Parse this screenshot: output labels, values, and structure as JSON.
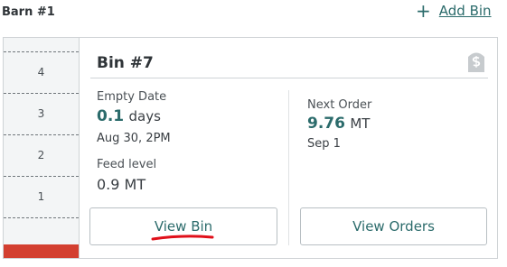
{
  "header": {
    "barn_title": "Barn #1",
    "add_bin_label": "Add Bin"
  },
  "bin": {
    "title": "Bin #7",
    "empty_date_label": "Empty Date",
    "empty_date_value": "0.1",
    "empty_date_unit": "days",
    "empty_date_time": "Aug 30, 2PM",
    "feed_level_label": "Feed level",
    "feed_level_value": "0.9 MT",
    "next_order_label": "Next Order",
    "next_order_value": "9.76",
    "next_order_unit": "MT",
    "next_order_date": "Sep 1",
    "fill_level_fraction": 0.06
  },
  "gauge": {
    "labels": [
      "4",
      "3",
      "2",
      "1"
    ]
  },
  "actions": {
    "view_bin_label": "View Bin",
    "view_orders_label": "View Orders"
  },
  "colors": {
    "accent": "#2b6b6b",
    "fill": "#d33f30",
    "annotation": "#e0101a"
  },
  "icons": {
    "add": "plus-icon",
    "bin_type": "silo-icon"
  }
}
